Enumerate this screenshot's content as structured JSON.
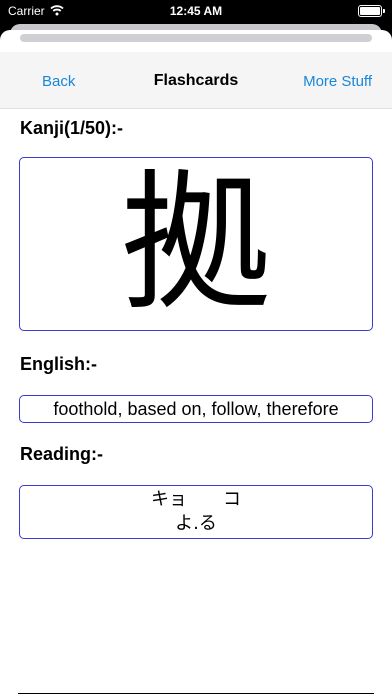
{
  "status_bar": {
    "carrier": "Carrier",
    "time": "12:45 AM"
  },
  "nav": {
    "back_label": "Back",
    "title": "Flashcards",
    "more_label": "More Stuff"
  },
  "kanji_section": {
    "label": "Kanji(1/50):-",
    "character": "拠"
  },
  "english_section": {
    "label": "English:-",
    "meaning": "foothold, based on, follow, therefore"
  },
  "reading_section": {
    "label": "Reading:-",
    "onyomi": "キョ　　コ",
    "kunyomi": "よ.る"
  },
  "colors": {
    "accent": "#1a86d9",
    "box_border": "#3b3bcf"
  },
  "icons": {
    "wifi": "wifi-icon",
    "battery": "battery-icon"
  }
}
